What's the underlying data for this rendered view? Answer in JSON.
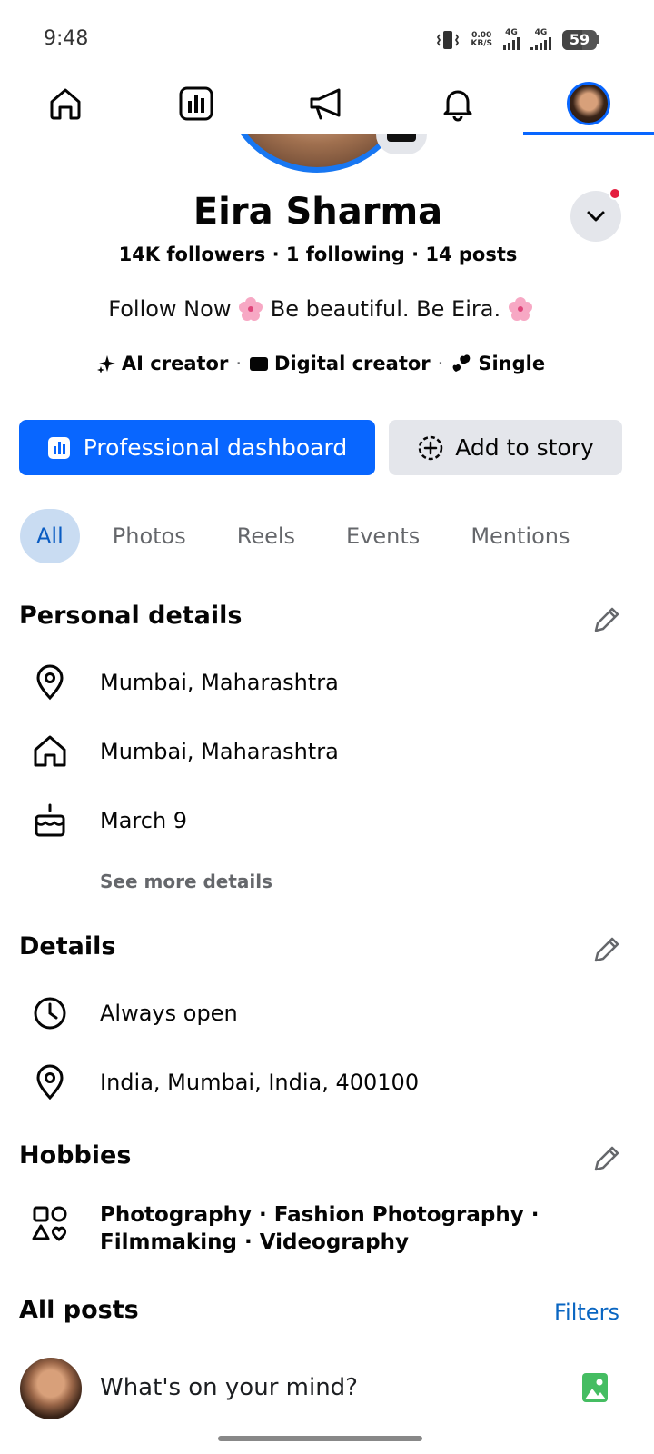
{
  "status_bar": {
    "time": "9:48",
    "net_speed_value": "0.00",
    "net_speed_unit": "KB/S",
    "network_1": "4G",
    "network_2": "4G",
    "battery": "59",
    "battery_level_percent": 59
  },
  "nav": {
    "items": [
      {
        "name": "home",
        "icon": "home-icon"
      },
      {
        "name": "dashboard",
        "icon": "bar-chart-icon"
      },
      {
        "name": "ads",
        "icon": "megaphone-icon"
      },
      {
        "name": "notifications",
        "icon": "bell-icon"
      },
      {
        "name": "profile",
        "icon": "avatar",
        "active": true
      }
    ]
  },
  "profile": {
    "name": "Eira Sharma",
    "stats": "14K followers · 1 following · 14 posts",
    "bio_part1": "Follow Now",
    "bio_part2": "Be beautiful. Be Eira.",
    "tags": [
      "AI creator",
      "Digital creator",
      "Single"
    ]
  },
  "actions": {
    "primary_label": "Professional dashboard",
    "secondary_label": "Add to story"
  },
  "tabs": [
    "All",
    "Photos",
    "Reels",
    "Events",
    "Mentions"
  ],
  "active_tab": "All",
  "personal_details": {
    "title": "Personal details",
    "rows": [
      {
        "icon": "location-pin-icon",
        "text": "Mumbai, Maharashtra"
      },
      {
        "icon": "home-icon",
        "text": "Mumbai, Maharashtra"
      },
      {
        "icon": "birthday-cake-icon",
        "text": "March 9"
      }
    ],
    "see_more": "See more details"
  },
  "details": {
    "title": "Details",
    "rows": [
      {
        "icon": "clock-icon",
        "text": "Always open"
      },
      {
        "icon": "location-pin-icon",
        "text": "India, Mumbai, India, 400100"
      }
    ]
  },
  "hobbies": {
    "title": "Hobbies",
    "line1": "Photography · Fashion Photography ·",
    "line2": "Filmmaking · Videography"
  },
  "posts": {
    "title": "All posts",
    "filters_label": "Filters",
    "composer_placeholder": "What's on your mind?"
  },
  "colors": {
    "accent": "#0866ff",
    "tab_active_bg": "#c9dcf2",
    "tab_active_text": "#0a5cc2",
    "secondary_bg": "#e4e6eb",
    "notification_dot": "#e41e3f",
    "photo_icon": "#45bd62"
  }
}
